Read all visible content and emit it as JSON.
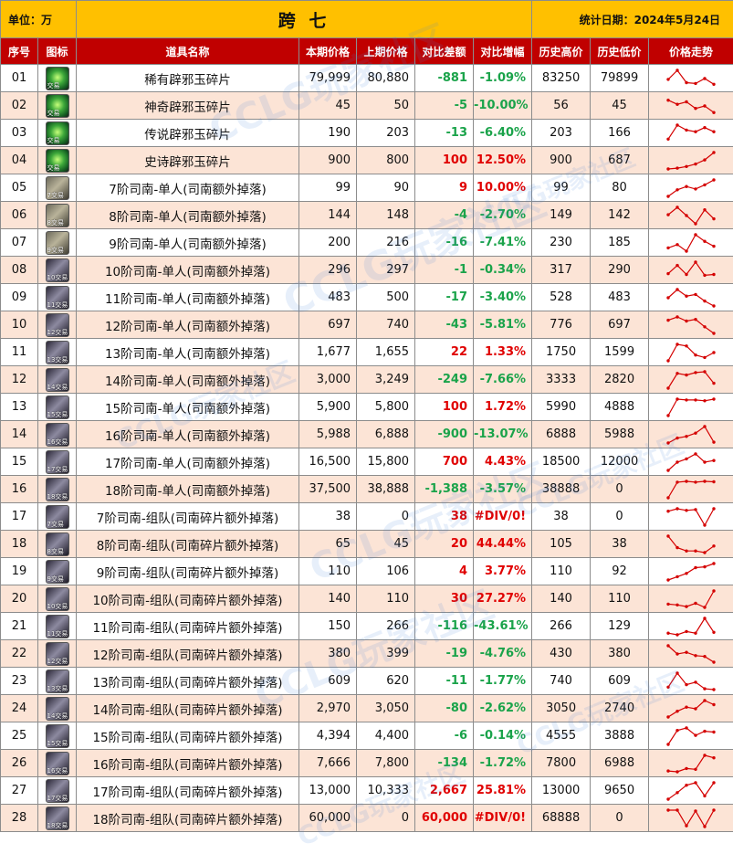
{
  "header": {
    "unit": "单位：万",
    "title": "跨 七",
    "date": "统计日期：2024年5月24日"
  },
  "columns": [
    "序号",
    "图标",
    "道具名称",
    "本期价格",
    "上期价格",
    "对比差额",
    "对比增幅",
    "历史高价",
    "历史低价",
    "价格走势"
  ],
  "watermark": "CCLG玩家社区",
  "colors": {
    "header_bar": "#ffc000",
    "column_header": "#c00000",
    "alt_row": "#fce4d6",
    "up": "#e00000",
    "down": "#1aa34a",
    "spark": "#d40000"
  },
  "rows": [
    {
      "no": "01",
      "icon": "ic-green",
      "icon_tag": "交易",
      "name": "稀有辟邪玉碎片",
      "cur": "79,999",
      "prev": "80,880",
      "diff": "-881",
      "rate": "-1.09%",
      "high": "83250",
      "low": "79899",
      "dir": "neg",
      "trend": [
        0.45,
        1.0,
        0.25,
        0.2,
        0.5,
        0.15
      ]
    },
    {
      "no": "02",
      "icon": "ic-green",
      "icon_tag": "交易",
      "name": "神奇辟邪玉碎片",
      "cur": "45",
      "prev": "50",
      "diff": "-5",
      "rate": "-10.00%",
      "high": "56",
      "low": "45",
      "dir": "neg",
      "trend": [
        0.85,
        0.6,
        0.75,
        0.35,
        0.5,
        0.1
      ]
    },
    {
      "no": "03",
      "icon": "ic-green",
      "icon_tag": "交易",
      "name": "传说辟邪玉碎片",
      "cur": "190",
      "prev": "203",
      "diff": "-13",
      "rate": "-6.40%",
      "high": "203",
      "low": "166",
      "dir": "neg",
      "trend": [
        0.15,
        1.0,
        0.7,
        0.6,
        0.85,
        0.6
      ]
    },
    {
      "no": "04",
      "icon": "ic-green",
      "icon_tag": "交易",
      "name": "史诗辟邪玉碎片",
      "cur": "900",
      "prev": "800",
      "diff": "100",
      "rate": "12.50%",
      "high": "900",
      "low": "687",
      "dir": "pos",
      "trend": [
        0.0,
        0.05,
        0.15,
        0.3,
        0.55,
        1.0
      ]
    },
    {
      "no": "05",
      "icon": "ic-gray",
      "icon_tag": "7交易",
      "name": "7阶司南-单人(司南额外掉落)",
      "cur": "99",
      "prev": "90",
      "diff": "9",
      "rate": "10.00%",
      "high": "99",
      "low": "80",
      "dir": "pos",
      "trend": [
        0.0,
        0.4,
        0.6,
        0.45,
        0.7,
        1.0
      ]
    },
    {
      "no": "06",
      "icon": "ic-gray",
      "icon_tag": "8交易",
      "name": "8阶司南-单人(司南额外掉落)",
      "cur": "144",
      "prev": "148",
      "diff": "-4",
      "rate": "-2.70%",
      "high": "149",
      "low": "142",
      "dir": "neg",
      "trend": [
        0.55,
        1.0,
        0.5,
        0.0,
        0.85,
        0.3
      ]
    },
    {
      "no": "07",
      "icon": "ic-gray",
      "icon_tag": "9交易",
      "name": "9阶司南-单人(司南额外掉落)",
      "cur": "200",
      "prev": "216",
      "diff": "-16",
      "rate": "-7.41%",
      "high": "230",
      "low": "185",
      "dir": "neg",
      "trend": [
        0.2,
        0.4,
        0.0,
        1.0,
        0.6,
        0.3
      ]
    },
    {
      "no": "08",
      "icon": "ic-dark",
      "icon_tag": "10交易",
      "name": "10阶司南-单人(司南额外掉落)",
      "cur": "296",
      "prev": "297",
      "diff": "-1",
      "rate": "-0.34%",
      "high": "317",
      "low": "290",
      "dir": "neg",
      "trend": [
        0.3,
        0.8,
        0.25,
        1.0,
        0.2,
        0.25
      ]
    },
    {
      "no": "09",
      "icon": "ic-dark",
      "icon_tag": "11交易",
      "name": "11阶司南-单人(司南额外掉落)",
      "cur": "483",
      "prev": "500",
      "diff": "-17",
      "rate": "-3.40%",
      "high": "528",
      "low": "483",
      "dir": "neg",
      "trend": [
        0.5,
        1.0,
        0.6,
        0.7,
        0.3,
        0.0
      ]
    },
    {
      "no": "10",
      "icon": "ic-dark",
      "icon_tag": "12交易",
      "name": "12阶司南-单人(司南额外掉落)",
      "cur": "697",
      "prev": "740",
      "diff": "-43",
      "rate": "-5.81%",
      "high": "776",
      "low": "697",
      "dir": "neg",
      "trend": [
        0.8,
        1.0,
        0.75,
        0.85,
        0.4,
        0.0
      ]
    },
    {
      "no": "11",
      "icon": "ic-dark",
      "icon_tag": "13交易",
      "name": "13阶司南-单人(司南额外掉落)",
      "cur": "1,677",
      "prev": "1,655",
      "diff": "22",
      "rate": "1.33%",
      "high": "1750",
      "low": "1599",
      "dir": "pos",
      "trend": [
        0.0,
        1.0,
        0.9,
        0.35,
        0.2,
        0.5
      ]
    },
    {
      "no": "12",
      "icon": "ic-dark",
      "icon_tag": "14交易",
      "name": "14阶司南-单人(司南额外掉落)",
      "cur": "3,000",
      "prev": "3,249",
      "diff": "-249",
      "rate": "-7.66%",
      "high": "3333",
      "low": "2820",
      "dir": "neg",
      "trend": [
        0.0,
        0.9,
        0.8,
        0.95,
        1.0,
        0.3
      ]
    },
    {
      "no": "13",
      "icon": "ic-dark",
      "icon_tag": "15交易",
      "name": "15阶司南-单人(司南额外掉落)",
      "cur": "5,900",
      "prev": "5,800",
      "diff": "100",
      "rate": "1.72%",
      "high": "5990",
      "low": "4888",
      "dir": "pos",
      "trend": [
        0.0,
        1.0,
        0.95,
        0.95,
        0.9,
        1.0
      ]
    },
    {
      "no": "14",
      "icon": "ic-dark",
      "icon_tag": "16交易",
      "name": "16阶司南-单人(司南额外掉落)",
      "cur": "5,988",
      "prev": "6,888",
      "diff": "-900",
      "rate": "-13.07%",
      "high": "6888",
      "low": "5988",
      "dir": "neg",
      "trend": [
        0.0,
        0.3,
        0.4,
        0.6,
        1.0,
        0.05
      ]
    },
    {
      "no": "15",
      "icon": "ic-dark",
      "icon_tag": "17交易",
      "name": "17阶司南-单人(司南额外掉落)",
      "cur": "16,500",
      "prev": "15,800",
      "diff": "700",
      "rate": "4.43%",
      "high": "18500",
      "low": "12000",
      "dir": "pos",
      "trend": [
        0.0,
        0.5,
        0.7,
        1.0,
        0.5,
        0.6
      ]
    },
    {
      "no": "16",
      "icon": "ic-dark",
      "icon_tag": "18交易",
      "name": "18阶司南-单人(司南额外掉落)",
      "cur": "37,500",
      "prev": "38,888",
      "diff": "-1,388",
      "rate": "-3.57%",
      "high": "38888",
      "low": "0",
      "dir": "neg",
      "trend": [
        0.0,
        0.95,
        1.0,
        0.95,
        1.0,
        0.97
      ]
    },
    {
      "no": "17",
      "icon": "ic-dark",
      "icon_tag": "7交易",
      "name": "7阶司南-组队(司南碎片额外掉落)",
      "cur": "38",
      "prev": "0",
      "diff": "38",
      "rate": "#DIV/0!",
      "high": "38",
      "low": "0",
      "dir": "pos",
      "trend": [
        0.85,
        1.0,
        0.9,
        0.95,
        0.0,
        1.0
      ]
    },
    {
      "no": "18",
      "icon": "ic-dark",
      "icon_tag": "8交易",
      "name": "8阶司南-组队(司南碎片额外掉落)",
      "cur": "65",
      "prev": "45",
      "diff": "20",
      "rate": "44.44%",
      "high": "105",
      "low": "38",
      "dir": "pos",
      "trend": [
        1.0,
        0.3,
        0.1,
        0.1,
        0.0,
        0.4
      ]
    },
    {
      "no": "19",
      "icon": "ic-dark",
      "icon_tag": "9交易",
      "name": "9阶司南-组队(司南碎片额外掉落)",
      "cur": "110",
      "prev": "106",
      "diff": "4",
      "rate": "3.77%",
      "high": "110",
      "low": "92",
      "dir": "pos",
      "trend": [
        0.0,
        0.2,
        0.4,
        0.75,
        0.8,
        1.0
      ]
    },
    {
      "no": "20",
      "icon": "ic-dark",
      "icon_tag": "10交易",
      "name": "10阶司南-组队(司南碎片额外掉落)",
      "cur": "140",
      "prev": "110",
      "diff": "30",
      "rate": "27.27%",
      "high": "140",
      "low": "110",
      "dir": "pos",
      "trend": [
        0.2,
        0.15,
        0.05,
        0.25,
        0.0,
        1.0
      ]
    },
    {
      "no": "21",
      "icon": "ic-dark",
      "icon_tag": "11交易",
      "name": "11阶司南-组队(司南碎片额外掉落)",
      "cur": "150",
      "prev": "266",
      "diff": "-116",
      "rate": "-43.61%",
      "high": "266",
      "low": "129",
      "dir": "neg",
      "trend": [
        0.1,
        0.0,
        0.2,
        0.1,
        1.0,
        0.15
      ]
    },
    {
      "no": "22",
      "icon": "ic-dark",
      "icon_tag": "12交易",
      "name": "12阶司南-组队(司南碎片额外掉落)",
      "cur": "380",
      "prev": "399",
      "diff": "-19",
      "rate": "-4.76%",
      "high": "430",
      "low": "380",
      "dir": "neg",
      "trend": [
        1.0,
        0.5,
        0.6,
        0.4,
        0.35,
        0.0
      ]
    },
    {
      "no": "23",
      "icon": "ic-dark",
      "icon_tag": "13交易",
      "name": "13阶司南-组队(司南碎片额外掉落)",
      "cur": "609",
      "prev": "620",
      "diff": "-11",
      "rate": "-1.77%",
      "high": "740",
      "low": "609",
      "dir": "neg",
      "trend": [
        0.15,
        1.0,
        0.3,
        0.45,
        0.05,
        0.0
      ]
    },
    {
      "no": "24",
      "icon": "ic-dark",
      "icon_tag": "14交易",
      "name": "14阶司南-组队(司南碎片额外掉落)",
      "cur": "2,970",
      "prev": "3,050",
      "diff": "-80",
      "rate": "-2.62%",
      "high": "3050",
      "low": "2740",
      "dir": "neg",
      "trend": [
        0.0,
        0.35,
        0.6,
        0.5,
        1.0,
        0.75
      ]
    },
    {
      "no": "25",
      "icon": "ic-dark",
      "icon_tag": "15交易",
      "name": "15阶司南-组队(司南碎片额外掉落)",
      "cur": "4,394",
      "prev": "4,400",
      "diff": "-6",
      "rate": "-0.14%",
      "high": "4555",
      "low": "3888",
      "dir": "neg",
      "trend": [
        0.0,
        0.85,
        1.0,
        0.55,
        0.8,
        0.75
      ]
    },
    {
      "no": "26",
      "icon": "ic-dark",
      "icon_tag": "16交易",
      "name": "16阶司南-组队(司南碎片额外掉落)",
      "cur": "7,666",
      "prev": "7,800",
      "diff": "-134",
      "rate": "-1.72%",
      "high": "7800",
      "low": "6988",
      "dir": "neg",
      "trend": [
        0.05,
        0.0,
        0.2,
        0.15,
        1.0,
        0.85
      ]
    },
    {
      "no": "27",
      "icon": "ic-dark",
      "icon_tag": "17交易",
      "name": "17阶司南-组队(司南碎片额外掉落)",
      "cur": "13,000",
      "prev": "10,333",
      "diff": "2,667",
      "rate": "25.81%",
      "high": "13000",
      "low": "9650",
      "dir": "pos",
      "trend": [
        0.0,
        0.4,
        0.85,
        1.0,
        0.2,
        1.0
      ]
    },
    {
      "no": "28",
      "icon": "ic-dark",
      "icon_tag": "18交易",
      "name": "18阶司南-组队(司南碎片额外掉落)",
      "cur": "60,000",
      "prev": "0",
      "diff": "60,000",
      "rate": "#DIV/0!",
      "high": "68888",
      "low": "0",
      "dir": "pos",
      "trend": [
        1.0,
        1.0,
        0.05,
        0.95,
        0.0,
        1.0
      ]
    }
  ]
}
